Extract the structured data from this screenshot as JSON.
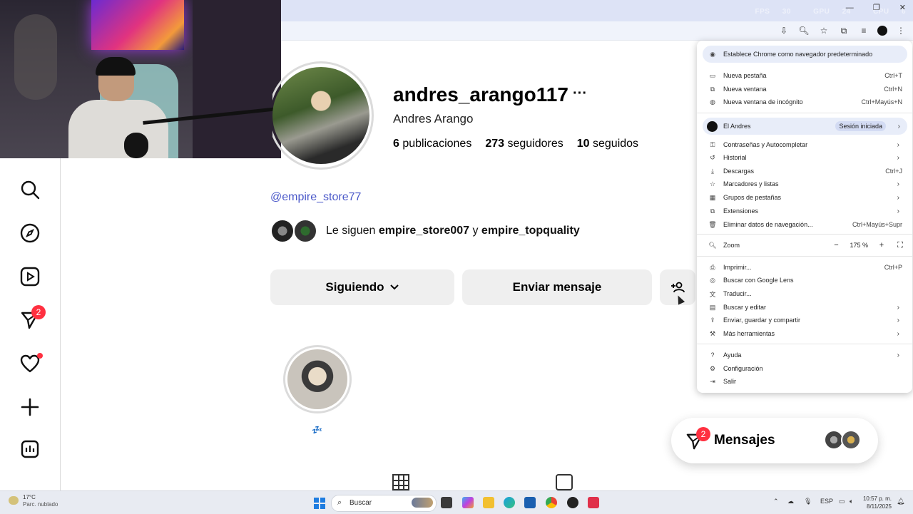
{
  "colors": {
    "accent": "#4a58c9",
    "badge": "#ff3040",
    "button_bg": "#efefef",
    "menu_highlight": "#e8edf9"
  },
  "perf_overlay": {
    "fps_label": "FPS",
    "fps_value": "30",
    "gpu_label": "GPU",
    "gpu_value": "24",
    "cpu_label": "CPU",
    "cpu_value": "6"
  },
  "nav": {
    "items": [
      {
        "icon": "search-icon"
      },
      {
        "icon": "explore-icon"
      },
      {
        "icon": "reels-icon"
      },
      {
        "icon": "messages-icon",
        "badge": "2"
      },
      {
        "icon": "heart-icon",
        "dot": true
      },
      {
        "icon": "create-icon"
      },
      {
        "icon": "dashboard-icon"
      }
    ]
  },
  "profile": {
    "username": "andres_arango117",
    "more": "···",
    "full_name": "Andres Arango",
    "posts_count": "6",
    "posts_label": "publicaciones",
    "followers_count": "273",
    "followers_label": "seguidores",
    "following_count": "10",
    "following_label": "seguidos",
    "handle": "@empire_store77",
    "followed_by_prefix": "Le siguen ",
    "followed_by_1": "empire_store007",
    "followed_by_joiner": " y ",
    "followed_by_2": "empire_topquality",
    "follow_button": "Siguiendo",
    "message_button": "Enviar mensaje",
    "highlight_label": "💤"
  },
  "messages_pill": {
    "label": "Mensajes",
    "badge": "2"
  },
  "chrome_menu": {
    "banner": "Establece Chrome como navegador predeterminado",
    "group1": [
      {
        "icon": "new-tab-icon",
        "label": "Nueva pestaña",
        "shortcut": "Ctrl+T"
      },
      {
        "icon": "new-window-icon",
        "label": "Nueva ventana",
        "shortcut": "Ctrl+N"
      },
      {
        "icon": "incognito-icon",
        "label": "Nueva ventana de incógnito",
        "shortcut": "Ctrl+Mayús+N"
      }
    ],
    "profile_name": "El Andres",
    "profile_status": "Sesión iniciada",
    "group2": [
      {
        "icon": "key-icon",
        "label": "Contraseñas y Autocompletar",
        "shortcut": "›"
      },
      {
        "icon": "history-icon",
        "label": "Historial",
        "shortcut": "›"
      },
      {
        "icon": "download-icon",
        "label": "Descargas",
        "shortcut": "Ctrl+J"
      },
      {
        "icon": "star-icon",
        "label": "Marcadores y listas",
        "shortcut": "›"
      },
      {
        "icon": "tab-groups-icon",
        "label": "Grupos de pestañas",
        "shortcut": "›"
      },
      {
        "icon": "extensions-icon",
        "label": "Extensiones",
        "shortcut": "›"
      },
      {
        "icon": "trash-icon",
        "label": "Eliminar datos de navegación...",
        "shortcut": "Ctrl+Mayús+Supr"
      }
    ],
    "zoom_label": "Zoom",
    "zoom_minus": "−",
    "zoom_value": "175 %",
    "zoom_plus": "+",
    "group3": [
      {
        "icon": "print-icon",
        "label": "Imprimir...",
        "shortcut": "Ctrl+P"
      },
      {
        "icon": "lens-icon",
        "label": "Buscar con Google Lens",
        "shortcut": ""
      },
      {
        "icon": "translate-icon",
        "label": "Traducir...",
        "shortcut": ""
      },
      {
        "icon": "find-icon",
        "label": "Buscar y editar",
        "shortcut": "›"
      },
      {
        "icon": "share-icon",
        "label": "Enviar, guardar y compartir",
        "shortcut": "›"
      },
      {
        "icon": "tools-icon",
        "label": "Más herramientas",
        "shortcut": "›"
      }
    ],
    "group4": [
      {
        "icon": "help-icon",
        "label": "Ayuda",
        "shortcut": "›"
      },
      {
        "icon": "settings-icon",
        "label": "Configuración",
        "shortcut": ""
      },
      {
        "icon": "exit-icon",
        "label": "Salir",
        "shortcut": ""
      }
    ]
  },
  "taskbar": {
    "weather_temp": "17°C",
    "weather_desc": "Parc. nublado",
    "search_placeholder": "Buscar",
    "lang": "ESP",
    "time": "10:57 p. m.",
    "date": "8/11/2025"
  }
}
